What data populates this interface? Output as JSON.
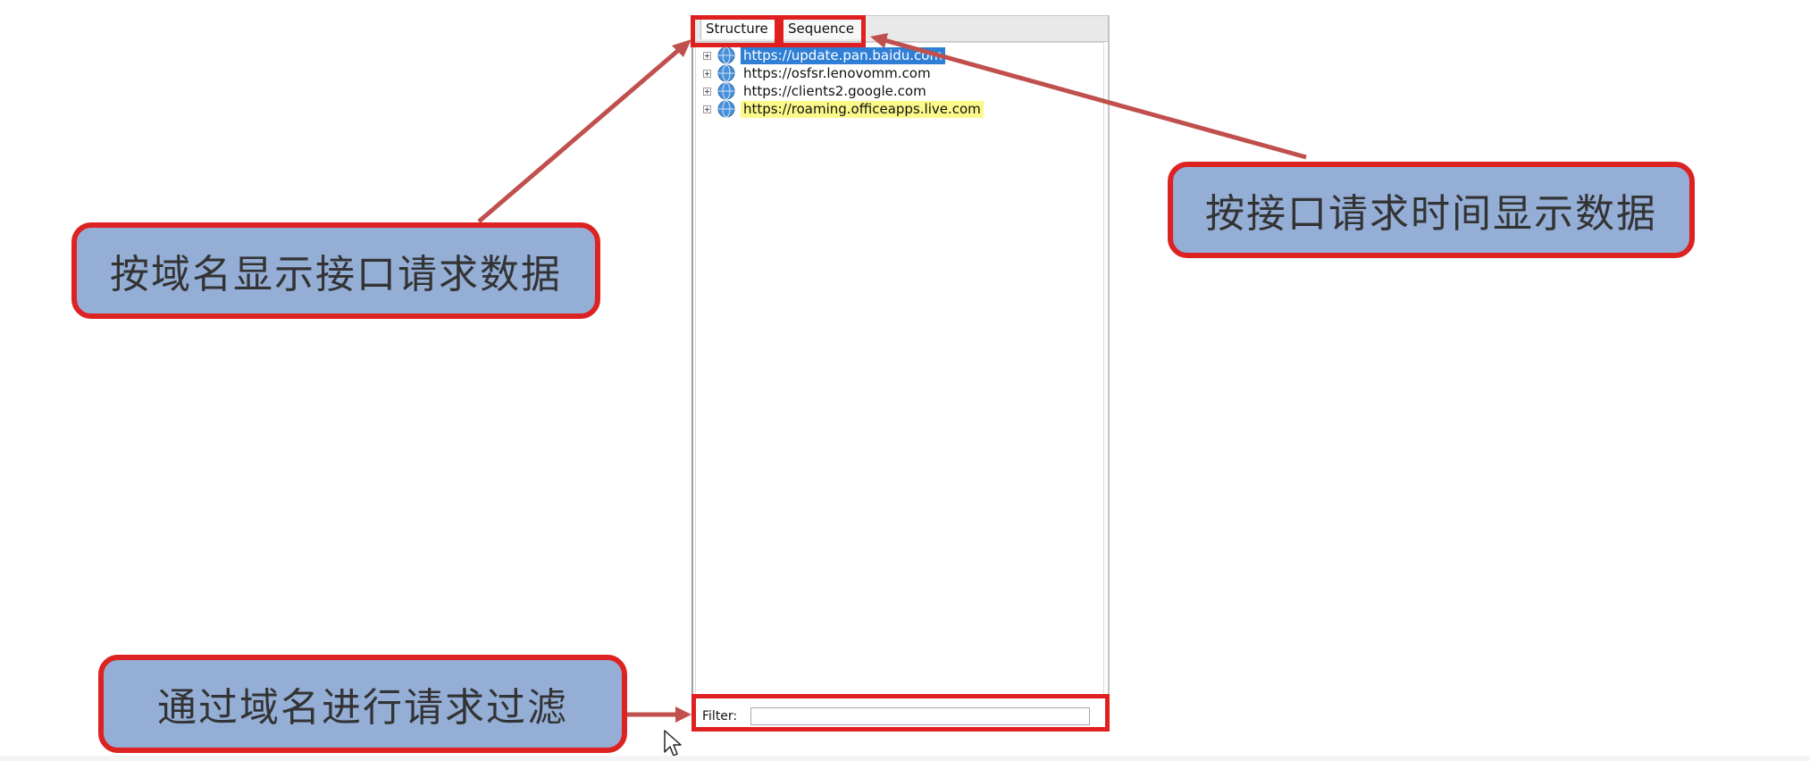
{
  "panel": {
    "tabs": [
      {
        "label": "Structure"
      },
      {
        "label": "Sequence"
      }
    ],
    "tree_items": [
      {
        "label": "https://update.pan.baidu.com",
        "state": "selected"
      },
      {
        "label": "https://osfsr.lenovomm.com",
        "state": "normal"
      },
      {
        "label": "https://clients2.google.com",
        "state": "normal"
      },
      {
        "label": "https://roaming.officeapps.live.com",
        "state": "highlighted"
      }
    ],
    "filter": {
      "label": "Filter:",
      "value": ""
    }
  },
  "callouts": {
    "domain_view": "按域名显示接口请求数据",
    "time_view": "按接口请求时间显示数据",
    "filter": "通过域名进行请求过滤"
  },
  "colors": {
    "callout_fill": "#94aed6",
    "callout_border": "#dd2222",
    "arrow": "#c0504d",
    "selection": "#2f7fd6",
    "highlight": "#fbf98a"
  },
  "icons": {
    "tree_expander": "plus-box-icon",
    "tree_node": "globe-icon",
    "pointer": "mouse-cursor-icon"
  }
}
